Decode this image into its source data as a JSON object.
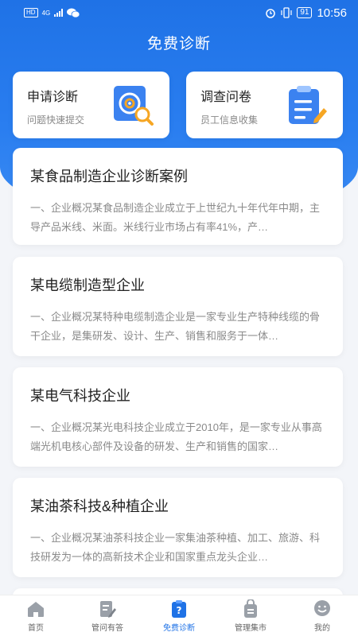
{
  "status": {
    "badge": "HD",
    "network": "4G",
    "battery": "91",
    "time": "10:56"
  },
  "header": {
    "title": "免费诊断"
  },
  "quick": [
    {
      "title": "申请诊断",
      "subtitle": "问题快速提交",
      "icon": "diagnosis-target-icon"
    },
    {
      "title": "调查问卷",
      "subtitle": "员工信息收集",
      "icon": "questionnaire-icon"
    }
  ],
  "cases": [
    {
      "title": "某食品制造企业诊断案例",
      "desc": "一、企业概况某食品制造企业成立于上世纪九十年代年中期，主导产品米线、米面。米线行业市场占有率41%，产…"
    },
    {
      "title": "某电缆制造型企业",
      "desc": "一、企业概况某特种电缆制造企业是一家专业生产特种线缆的骨干企业，是集研发、设计、生产、销售和服务于一体…"
    },
    {
      "title": "某电气科技企业",
      "desc": "一、企业概况某光电科技企业成立于2010年，是一家专业从事高端光机电核心部件及设备的研发、生产和销售的国家…"
    },
    {
      "title": "某油茶科技&种植企业",
      "desc": "一、企业概况某油茶科技企业一家集油茶种植、加工、旅游、科技研发为一体的高新技术企业和国家重点龙头企业…"
    }
  ],
  "tabs": [
    {
      "label": "首页",
      "icon": "home-icon"
    },
    {
      "label": "管问有答",
      "icon": "edit-note-icon"
    },
    {
      "label": "免费诊断",
      "icon": "clipboard-question-icon",
      "active": true
    },
    {
      "label": "管理集市",
      "icon": "bag-icon"
    },
    {
      "label": "我的",
      "icon": "profile-icon"
    }
  ],
  "colors": {
    "brand": "#1f72e6",
    "background": "#f3f5f9",
    "tab_inactive": "#9aa0a8"
  }
}
